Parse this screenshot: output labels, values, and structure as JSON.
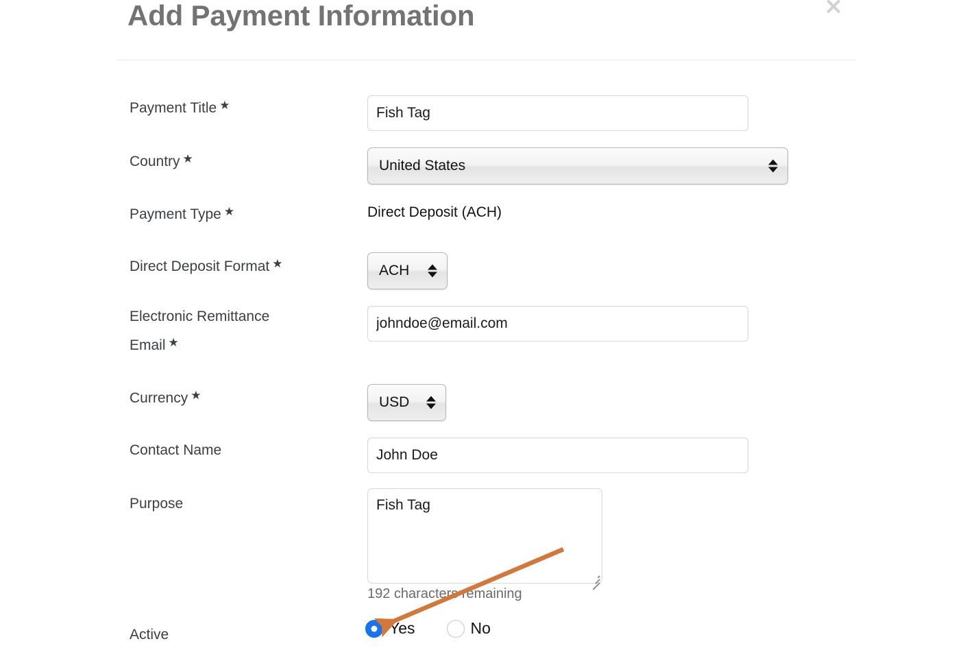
{
  "dialog": {
    "title": "Add Payment Information",
    "close_label": "×",
    "close_icon": "close-icon"
  },
  "fields": [
    {
      "label": "Payment Title",
      "required": true,
      "required_mark": "★",
      "type": "text",
      "value": "Fish Tag"
    },
    {
      "label": "Country",
      "required": true,
      "required_mark": "★",
      "type": "select",
      "value": "United States"
    },
    {
      "label": "Payment Type",
      "required": true,
      "required_mark": "★",
      "type": "static",
      "value": "Direct Deposit (ACH)"
    },
    {
      "label": "Direct Deposit Format",
      "required": true,
      "required_mark": "★",
      "type": "select",
      "value": "ACH"
    },
    {
      "label": "Electronic Remittance Email",
      "required": true,
      "required_mark": "★",
      "type": "text",
      "value": "johndoe@email.com"
    },
    {
      "label": "Currency",
      "required": true,
      "required_mark": "★",
      "type": "select",
      "value": "USD"
    },
    {
      "label": "Contact Name",
      "required": false,
      "required_mark": "",
      "type": "text",
      "value": "John Doe"
    },
    {
      "label": "Purpose",
      "required": false,
      "required_mark": "",
      "type": "textarea",
      "value": "Fish Tag",
      "counter": "192 characters remaining"
    },
    {
      "label": "Active",
      "required": false,
      "required_mark": "",
      "type": "radio",
      "value": "Yes",
      "options": [
        "Yes",
        "No"
      ]
    }
  ],
  "colors": {
    "title": "#737373",
    "label": "#3b3f44",
    "value": "#111111",
    "radio_selected": "#1a73e8",
    "annotation_arrow": "#d4773a",
    "divider": "#e8e8e8"
  }
}
